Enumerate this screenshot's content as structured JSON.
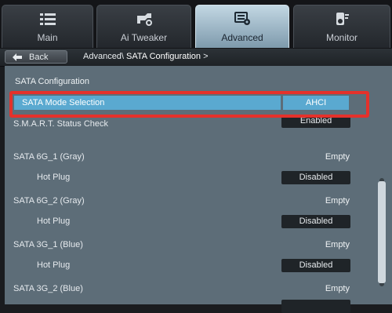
{
  "tabs": [
    {
      "label": "Main",
      "icon": "list-icon",
      "active": false
    },
    {
      "label": "Ai  Tweaker",
      "icon": "tweaker-icon",
      "active": false
    },
    {
      "label": "Advanced",
      "icon": "advanced-icon",
      "active": true
    },
    {
      "label": "Monitor",
      "icon": "monitor-gauge-icon",
      "active": false
    }
  ],
  "breadcrumb": {
    "back_label": "Back",
    "path": "Advanced\\",
    "current": "SATA Configuration",
    "arrow": ">"
  },
  "page": {
    "section_title": "SATA Configuration",
    "mode_label": "SATA Mode Selection",
    "mode_value": "AHCI",
    "smart_label": "S.M.A.R.T. Status Check",
    "smart_value": "Enabled",
    "ports": [
      {
        "name": "SATA 6G_1 (Gray)",
        "status": "Empty",
        "hotplug_label": "Hot Plug",
        "hotplug_value": "Disabled"
      },
      {
        "name": "SATA 6G_2 (Gray)",
        "status": "Empty",
        "hotplug_label": "Hot Plug",
        "hotplug_value": "Disabled"
      },
      {
        "name": "SATA 3G_1 (Blue)",
        "status": "Empty",
        "hotplug_label": "Hot Plug",
        "hotplug_value": "Disabled"
      },
      {
        "name": "SATA 3G_2 (Blue)",
        "status": "Empty"
      }
    ]
  },
  "colors": {
    "selection": "#5aa9d0",
    "highlight_border": "#e4312b",
    "panel": "#5d6d78",
    "value_box": "#1f2428"
  }
}
